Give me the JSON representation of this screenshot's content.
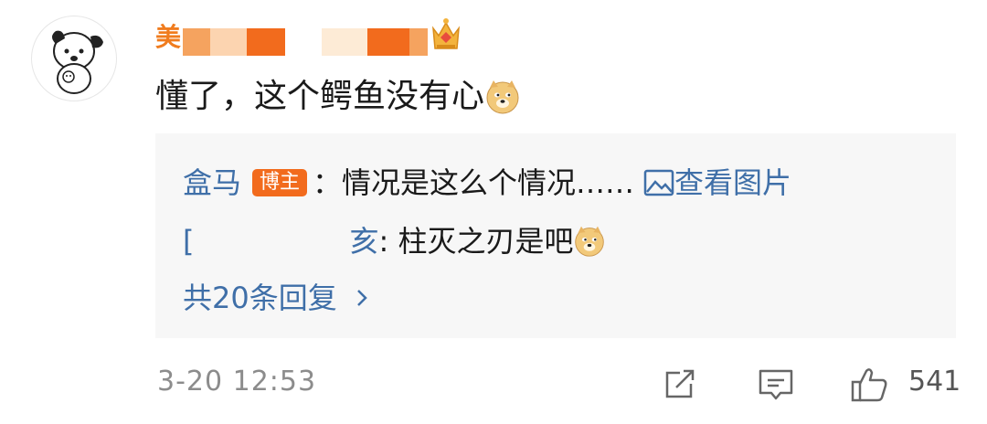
{
  "comment": {
    "username": "美",
    "text": "懂了，这个鳄鱼没有心",
    "time": "3-20 12:53",
    "like_count": "541"
  },
  "replies": {
    "first": {
      "name": "盒马",
      "badge": "博主",
      "text": "：情况是这么个情况……",
      "link": "查看图片"
    },
    "second": {
      "name_fragment": "[",
      "name_tail": "亥",
      "text": ": 柱灭之刃是吧"
    },
    "more": "共20条回复"
  },
  "icons": {
    "avatar": "cartoon-dog-avatar",
    "crown": "vip-crown-icon",
    "emoji": "doge-emoji",
    "image": "image-icon",
    "share": "share-icon",
    "comment": "comment-icon",
    "like": "thumbs-up-icon",
    "chevron": "chevron-right-icon"
  },
  "colors": {
    "username": "#f07c1e",
    "link": "#3f6fa8",
    "badge": "#f26b1d",
    "reply_bg": "#f7f7f7",
    "muted": "#8c8c8c"
  }
}
